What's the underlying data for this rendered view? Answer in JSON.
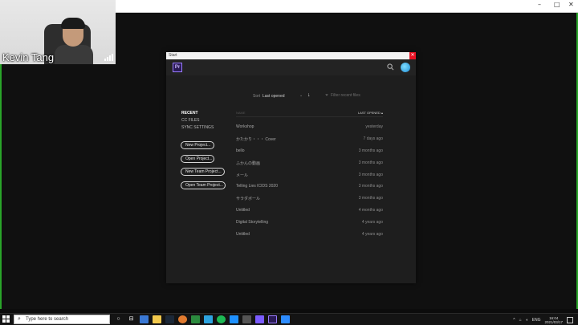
{
  "app_window": {
    "controls": [
      "–",
      "□",
      "✕"
    ]
  },
  "video_call": {
    "participant_name": "Kevin Tang"
  },
  "premiere": {
    "title": "Start",
    "logo_text": "Pr",
    "close_glyph": "✕",
    "search_icon": "search-icon",
    "sort": {
      "label": "Sort",
      "value": "Last opened",
      "chevron": "⌄",
      "direction": "↓"
    },
    "filter_placeholder": "Filter recent files",
    "nav": [
      "RECENT",
      "CC FILES",
      "SYNC SETTINGS"
    ],
    "buttons": [
      "New Project...",
      "Open Project...",
      "New Team Project...",
      "Open Team Project..."
    ],
    "list": {
      "name_header": "NAME",
      "sort_header": "LAST OPENED ▴",
      "rows": [
        {
          "name": "Workshop",
          "date": "yesterday"
        },
        {
          "name": "かたかり・・・ Cover",
          "date": "7 days ago"
        },
        {
          "name": "bello",
          "date": "3 months ago"
        },
        {
          "name": "ふかんの動画",
          "date": "3 months ago"
        },
        {
          "name": "メール",
          "date": "3 months ago"
        },
        {
          "name": "Telling Lies ICIDS 2020",
          "date": "3 months ago"
        },
        {
          "name": "サラダボール",
          "date": "3 months ago"
        },
        {
          "name": "Untitled",
          "date": "4 months ago"
        },
        {
          "name": "Digital Storytelling",
          "date": "4 years ago"
        },
        {
          "name": "Untitled",
          "date": "4 years ago"
        }
      ]
    }
  },
  "taskbar": {
    "search_placeholder": "Type here to search",
    "tray_lang": "ENG",
    "clock_time": "16:04",
    "clock_date": "2021/03/17"
  }
}
